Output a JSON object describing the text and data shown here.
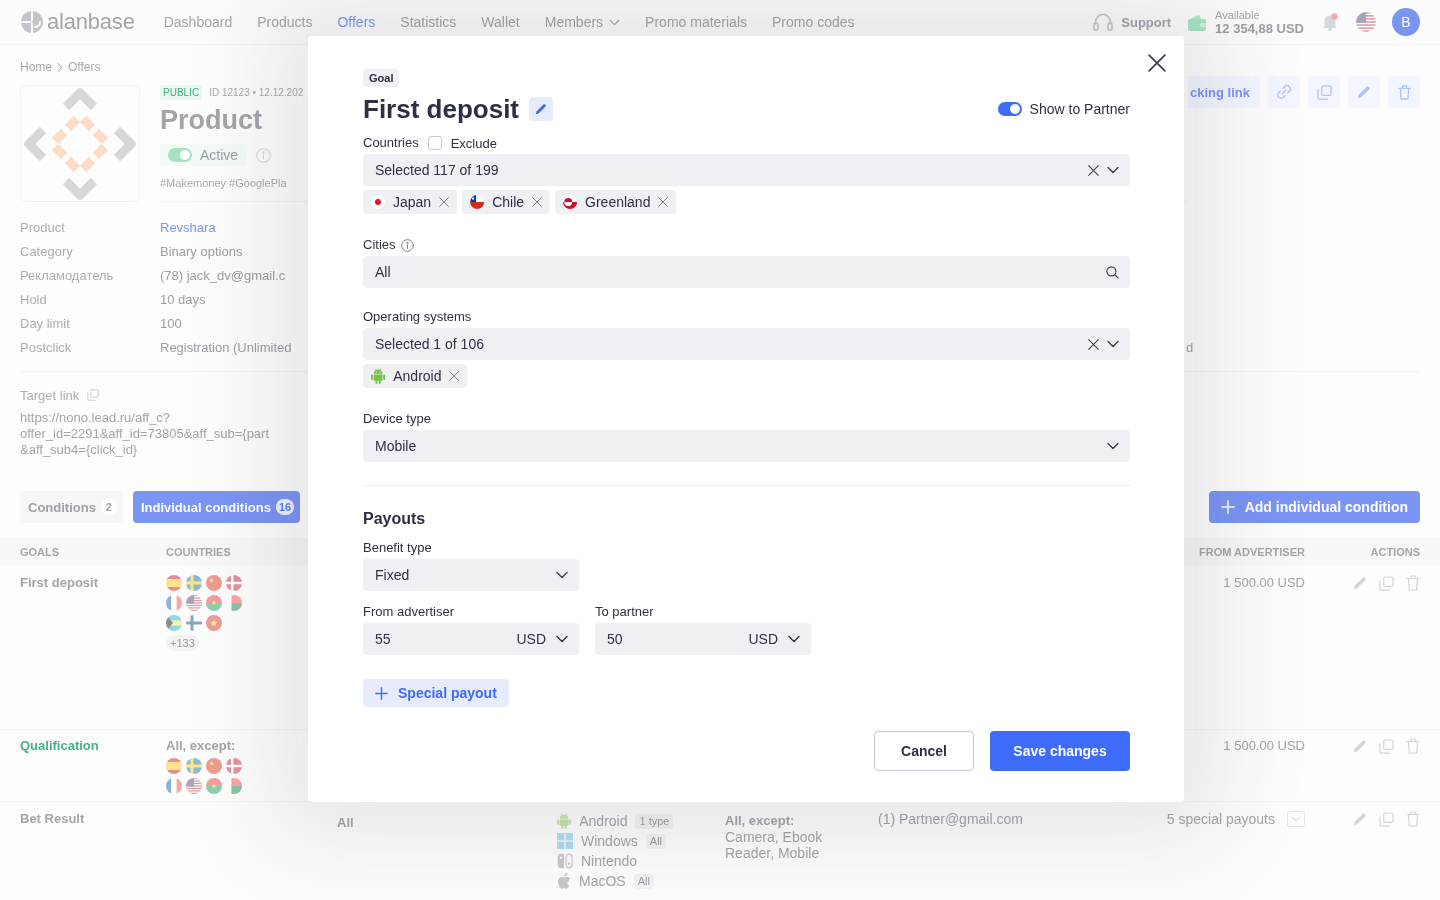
{
  "header": {
    "logo_text": "alanbase",
    "nav": [
      {
        "label": "Dashboard",
        "selected": false,
        "dropdown": false
      },
      {
        "label": "Products",
        "selected": false,
        "dropdown": false
      },
      {
        "label": "Offers",
        "selected": true,
        "dropdown": false
      },
      {
        "label": "Statistics",
        "selected": false,
        "dropdown": false
      },
      {
        "label": "Wallet",
        "selected": false,
        "dropdown": false
      },
      {
        "label": "Members",
        "selected": false,
        "dropdown": true
      },
      {
        "label": "Promo materials",
        "selected": false,
        "dropdown": false
      },
      {
        "label": "Promo codes",
        "selected": false,
        "dropdown": false
      }
    ],
    "support": "Support",
    "balance": {
      "label": "Available",
      "amount": "12 354,88 USD"
    },
    "notifications": {
      "unread": true
    },
    "avatar": "B"
  },
  "breadcrumbs": [
    "Home",
    "Offers"
  ],
  "offer": {
    "visibility": "PUBLIC",
    "meta": "ID 12123 • 12.12.202",
    "title": "Product",
    "status": {
      "label": "Active",
      "on": true
    },
    "hashtags": "#Makemoney #GooglePla",
    "tracking_link": "cking link",
    "details": [
      {
        "label": "Product",
        "value": "Revshara",
        "link": true
      },
      {
        "label": "Category",
        "value": "Binary options",
        "link": false
      },
      {
        "label": "Рекламодатель",
        "value": "(78) jack_dv@gmail.c",
        "link": false
      },
      {
        "label": "Hold",
        "value": "10 days",
        "link": false
      },
      {
        "label": "Day limit",
        "value": "100",
        "link": false
      },
      {
        "label": "Postclick",
        "value": "Registration (Unlimited",
        "link": false
      }
    ],
    "details_column_2": "d",
    "target_link": {
      "label": "Target link",
      "lines": [
        "https://nono.lead.ru/aff_c?",
        "offer_id=2291&aff_id=73805&aff_sub={part",
        "&aff_sub4={click_id}"
      ]
    }
  },
  "conditions": {
    "tabs": [
      {
        "label": "Conditions",
        "count": "2",
        "selected": false
      },
      {
        "label": "Individual conditions",
        "count": "16",
        "selected": true
      }
    ],
    "add_button": "Add individual condition"
  },
  "table": {
    "columns": {
      "goals": "GOALS",
      "countries": "COUNTRIES",
      "from_advertiser": "FROM ADVERTISER",
      "actions": "ACTIONS"
    },
    "rows": [
      {
        "goal": "First deposit",
        "highlighted": false,
        "countries": {
          "flags": [
            {
              "kind": "es"
            },
            {
              "kind": "se"
            },
            {
              "kind": "cn"
            },
            {
              "kind": "dk"
            },
            {
              "kind": "fr"
            },
            {
              "kind": "us"
            },
            {
              "kind": "bf"
            },
            {
              "kind": "mg"
            },
            {
              "kind": "bs"
            },
            {
              "kind": "fi"
            },
            {
              "kind": "vn"
            }
          ],
          "more": "+133"
        },
        "from_advertiser": {
          "kind": "amount",
          "text": "1 500.00 USD"
        }
      },
      {
        "goal": "Qualification",
        "highlighted": true,
        "countries": {
          "heading": "All, except:",
          "flags": [
            {
              "kind": "es"
            },
            {
              "kind": "se"
            },
            {
              "kind": "cn"
            },
            {
              "kind": "dk"
            },
            {
              "kind": "fr"
            },
            {
              "kind": "us"
            },
            {
              "kind": "bf"
            },
            {
              "kind": "mg"
            }
          ]
        },
        "from_advertiser": {
          "kind": "amount",
          "text": "1 500.00 USD"
        }
      },
      {
        "goal": "Bet Result",
        "highlighted": false,
        "column_3": "All",
        "column_4": [
          {
            "kind": "android",
            "name": "Android",
            "note": "1 type"
          },
          {
            "kind": "windows",
            "name": "Windows",
            "note": "All"
          },
          {
            "kind": "nintendo",
            "name": "Nintendo"
          },
          {
            "kind": "macos",
            "name": "MacOS",
            "note": "All"
          }
        ],
        "column_5": {
          "heading": "All, except:",
          "text": "Camera, Ebook Reader, Mobile"
        },
        "column_6": "(1) Partner@gmail.com",
        "from_advertiser": {
          "kind": "menu",
          "text": "5 special payouts"
        }
      }
    ]
  },
  "modal": {
    "chip": "Goal",
    "title": "First deposit",
    "show_to_partner": {
      "label": "Show to Partner",
      "on": true
    },
    "countries": {
      "label": "Countries",
      "exclude": {
        "label": "Exclude",
        "checked": false
      },
      "value": "Selected 117 of 199",
      "tags": [
        {
          "kind": "jp",
          "label": "Japan"
        },
        {
          "kind": "cl",
          "label": "Chile"
        },
        {
          "kind": "gl",
          "label": "Greenland"
        }
      ]
    },
    "cities": {
      "label": "Cities",
      "value": "All"
    },
    "operating_systems": {
      "label": "Operating systems",
      "value": "Selected 1 of 106",
      "tags": [
        {
          "kind": "android",
          "label": "Android"
        }
      ]
    },
    "device_type": {
      "label": "Device type",
      "value": "Mobile"
    },
    "payouts": {
      "title": "Payouts",
      "benefit_type": {
        "label": "Benefit type",
        "value": "Fixed"
      },
      "from_advertiser": {
        "label": "From advertiser",
        "value": "55",
        "currency": "USD"
      },
      "to_partner": {
        "label": "To partner",
        "value": "50",
        "currency": "USD"
      },
      "special_payout": "Special payout"
    },
    "buttons": [
      {
        "kind": "secondary",
        "label": "Cancel"
      },
      {
        "kind": "primary",
        "label": "Save changes"
      }
    ]
  }
}
